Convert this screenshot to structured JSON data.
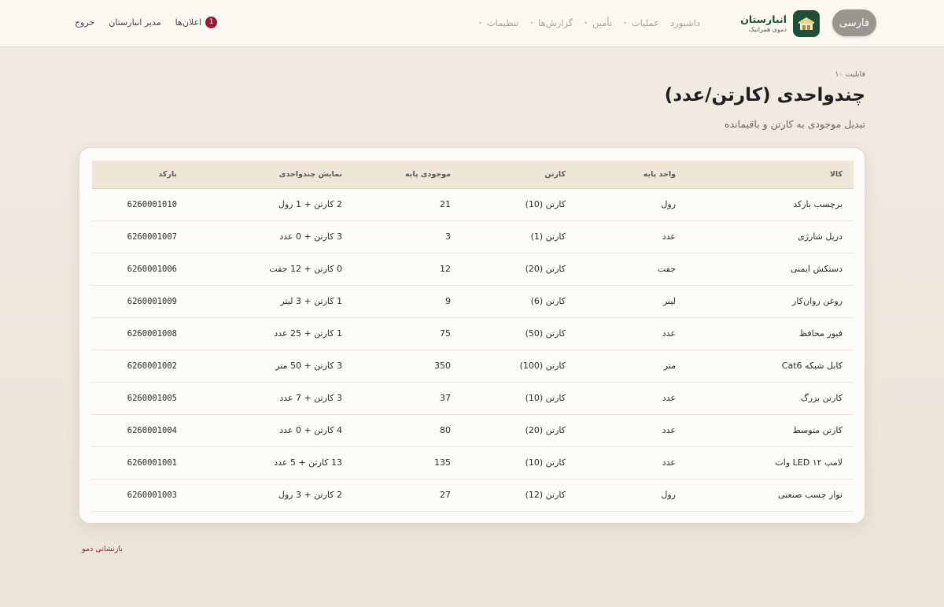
{
  "header": {
    "lang_button": "فارسی",
    "brand_name": "انبارستان",
    "brand_subtitle": "دموی همرانیک",
    "nav": [
      "داشبورد",
      "عملیات",
      "تأمین",
      "گزارش‌ها",
      "تنظیمات"
    ],
    "notifications_label": "اعلان‌ها",
    "notifications_count": "1",
    "user_label": "مدیر انبارستان",
    "logout_label": "خروج"
  },
  "page": {
    "kicker": "قابلیت ۱۰",
    "title": "چندواحدی (کارتن/عدد)",
    "subtitle": "تبدیل موجودی به کارتن و باقیمانده"
  },
  "table": {
    "columns": [
      "کالا",
      "واحد پایه",
      "کارتن",
      "موجودی پایه",
      "نمایش چندواحدی",
      "بارکد"
    ],
    "rows": [
      [
        "برچسب بارکد",
        "رول",
        "کارتن (10)",
        "21",
        "2 کارتن + 1 رول",
        "6260001010"
      ],
      [
        "دریل شارژی",
        "عدد",
        "کارتن (1)",
        "3",
        "3 کارتن + 0 عدد",
        "6260001007"
      ],
      [
        "دستکش ایمنی",
        "جفت",
        "کارتن (20)",
        "12",
        "0 کارتن + 12 جفت",
        "6260001006"
      ],
      [
        "روغن روان‌کار",
        "لیتر",
        "کارتن (6)",
        "9",
        "1 کارتن + 3 لیتر",
        "6260001009"
      ],
      [
        "فیوز محافظ",
        "عدد",
        "کارتن (50)",
        "75",
        "1 کارتن + 25 عدد",
        "6260001008"
      ],
      [
        "کابل شبکه Cat6",
        "متر",
        "کارتن (100)",
        "350",
        "3 کارتن + 50 متر",
        "6260001002"
      ],
      [
        "کارتن بزرگ",
        "عدد",
        "کارتن (10)",
        "37",
        "3 کارتن + 7 عدد",
        "6260001005"
      ],
      [
        "کارتن متوسط",
        "عدد",
        "کارتن (20)",
        "80",
        "4 کارتن + 0 عدد",
        "6260001004"
      ],
      [
        "لامپ LED ۱۲ وات",
        "عدد",
        "کارتن (10)",
        "135",
        "13 کارتن + 5 عدد",
        "6260001001"
      ],
      [
        "نوار چسب صنعتی",
        "رول",
        "کارتن (12)",
        "27",
        "2 کارتن + 3 رول",
        "6260001003"
      ]
    ]
  },
  "footer": {
    "reset_link": "بازنشانی دمو"
  }
}
